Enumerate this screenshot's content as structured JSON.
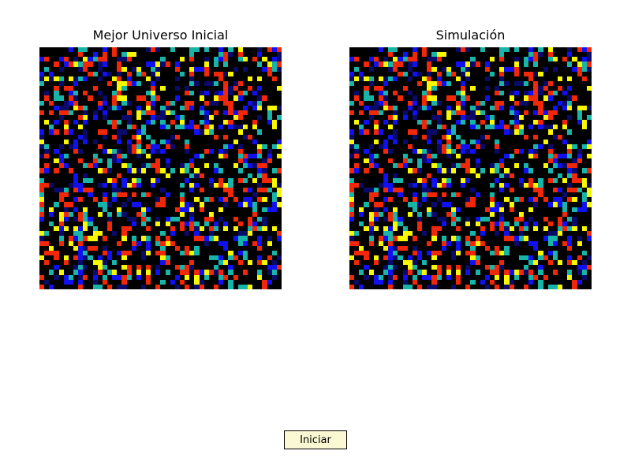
{
  "window": {
    "panels": [
      {
        "title": "Mejor Universo Inicial"
      },
      {
        "title": "Simulación"
      }
    ],
    "button": {
      "label": "Iniciar"
    }
  },
  "grid": {
    "rows": 50,
    "cols": 50,
    "palette": {
      "0": "#000000",
      "1": "#0a0a6b",
      "2": "#1010f0",
      "3": "#18b4a8",
      "4": "#f02808",
      "5": "#f8f800"
    },
    "seed": 20240517
  }
}
